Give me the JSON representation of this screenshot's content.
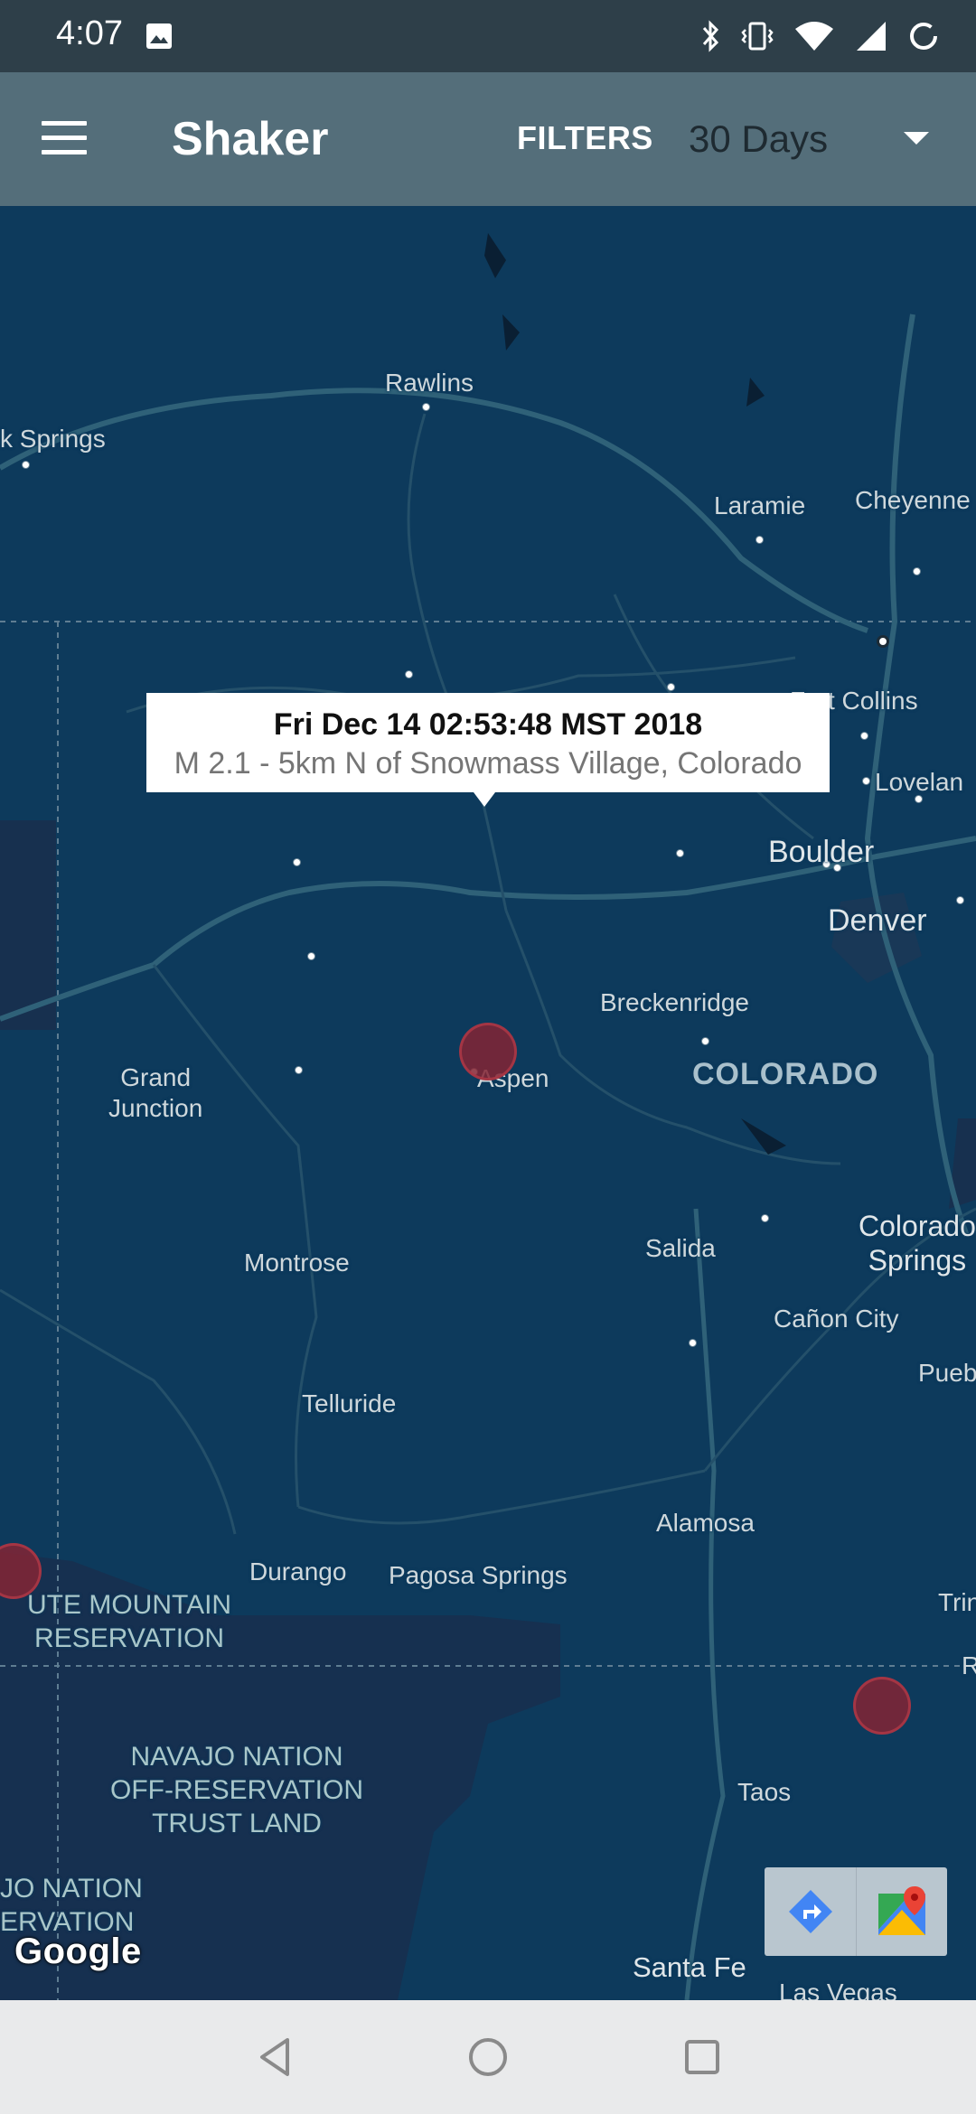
{
  "status_bar": {
    "time": "4:07",
    "icons": [
      "image-icon",
      "bluetooth-icon",
      "vibrate-icon",
      "wifi-icon",
      "signal-icon",
      "battery-charging-icon"
    ]
  },
  "app_bar": {
    "title": "Shaker",
    "filters_label": "FILTERS",
    "time_range": "30 Days",
    "menu_icon": "hamburger-menu-icon"
  },
  "map": {
    "labels": {
      "rawlins": "Rawlins",
      "springs": "k Springs",
      "laramie": "Laramie",
      "cheyenne": "Cheyenne",
      "fort_collins": "Fort Collins",
      "loveland": "Lovelan",
      "boulder": "Boulder",
      "denver": "Denver",
      "breckenridge": "Breckenridge",
      "colorado": "COLORADO",
      "aspen": "Aspen",
      "grand_junction": "Grand\nJunction",
      "montrose": "Montrose",
      "salida": "Salida",
      "colorado_springs": "Colorado\nSprings",
      "canon_city": "Cañon City",
      "pueblo": "Pueb",
      "telluride": "Telluride",
      "alamosa": "Alamosa",
      "durango": "Durango",
      "pagosa_springs": "Pagosa Springs",
      "trinidad": "Trin",
      "raton": "R",
      "ute_mountain": "UTE MOUNTAIN\nRESERVATION",
      "navajo_off": "NAVAJO NATION\nOFF-RESERVATION\nTRUST LAND",
      "navajo_res": "JO NATION\nERVATION",
      "taos": "Taos",
      "santa_fe": "Santa Fe",
      "las_vegas": "Las Vegas"
    },
    "info_window": {
      "title": "Fri Dec 14 02:53:48 MST 2018",
      "subtitle": "M 2.1 - 5km N of Snowmass Village, Colorado"
    },
    "google_logo": "Google",
    "toolbar": [
      "directions-icon",
      "google-maps-icon"
    ]
  },
  "nav_bar": {
    "buttons": [
      "back-icon",
      "home-icon",
      "recents-icon"
    ]
  },
  "colors": {
    "status_bar": "#2e3f49",
    "app_bar": "#546e7a",
    "map_water": "#0d3a5c",
    "quake_marker": "#84243a"
  }
}
